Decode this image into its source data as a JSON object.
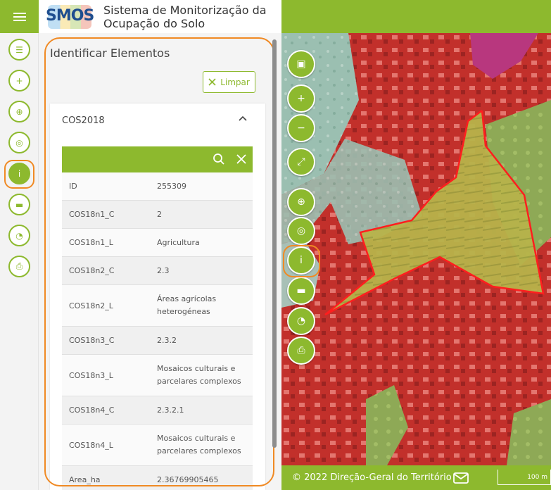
{
  "header": {
    "logo_text": "SMOS",
    "title_line1": "Sistema de Monitorização da",
    "title_line2": "Ocupação do Solo",
    "menu_icon": "hamburger-icon"
  },
  "rail": [
    {
      "name": "layers-list-icon",
      "glyph": "☰"
    },
    {
      "name": "add-layer-icon",
      "glyph": "+"
    },
    {
      "name": "globe-icon",
      "glyph": "⊕"
    },
    {
      "name": "target-icon",
      "glyph": "◎"
    },
    {
      "name": "info-icon",
      "glyph": "i",
      "active": true
    },
    {
      "name": "ruler-icon",
      "glyph": "▬"
    },
    {
      "name": "palette-icon",
      "glyph": "◔"
    },
    {
      "name": "print-icon",
      "glyph": "⎙"
    }
  ],
  "panel": {
    "title": "Identificar Elementos",
    "clear_label": "Limpar",
    "card_title": "COS2018",
    "rows": [
      {
        "key": "ID",
        "value": "255309"
      },
      {
        "key": "COS18n1_C",
        "value": "2"
      },
      {
        "key": "COS18n1_L",
        "value": "Agricultura"
      },
      {
        "key": "COS18n2_C",
        "value": "2.3"
      },
      {
        "key": "COS18n2_L",
        "value": "Áreas agrícolas heterogéneas"
      },
      {
        "key": "COS18n3_C",
        "value": "2.3.2"
      },
      {
        "key": "COS18n3_L",
        "value": "Mosaicos culturais e parcelares complexos"
      },
      {
        "key": "COS18n4_C",
        "value": "2.3.2.1"
      },
      {
        "key": "COS18n4_L",
        "value": "Mosaicos culturais e parcelares complexos"
      },
      {
        "key": "Area_ha",
        "value": "2.36769905465"
      }
    ]
  },
  "map_controls": [
    {
      "name": "basemap-image-icon",
      "glyph": "▣"
    },
    {
      "name": "zoom-in-icon",
      "glyph": "+"
    },
    {
      "name": "zoom-out-icon",
      "glyph": "−"
    },
    {
      "name": "fullscreen-icon",
      "glyph": "⤢"
    },
    {
      "name": "globe-icon",
      "glyph": "⊕"
    },
    {
      "name": "target-icon",
      "glyph": "◎"
    },
    {
      "name": "info-icon",
      "glyph": "i"
    },
    {
      "name": "ruler-icon",
      "glyph": "▬"
    },
    {
      "name": "palette-icon",
      "glyph": "◔"
    },
    {
      "name": "print-icon",
      "glyph": "⎙"
    }
  ],
  "footer": {
    "copyright": "© 2022 Direção-Geral do Território",
    "scale_label": "100 m"
  },
  "colors": {
    "accent": "#8db92e",
    "highlight": "#f08a24",
    "map_red": "#d9302a",
    "map_yellow": "#c9c34a",
    "map_teal": "#8fb7a8"
  }
}
